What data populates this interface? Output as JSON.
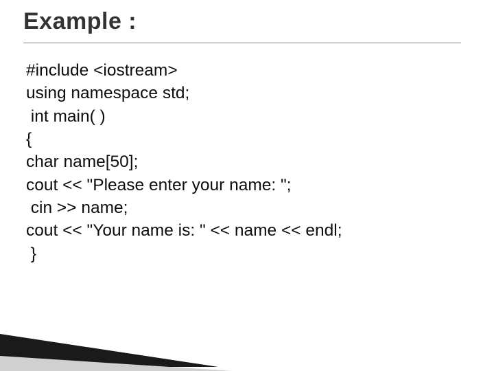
{
  "title": "Example :",
  "code": [
    "#include <iostream>",
    "using namespace std;",
    " int main( )",
    "{",
    "char name[50];",
    "cout << \"Please enter your name: \";",
    " cin >> name;",
    "cout << \"Your name is: \" << name << endl;",
    " }"
  ]
}
